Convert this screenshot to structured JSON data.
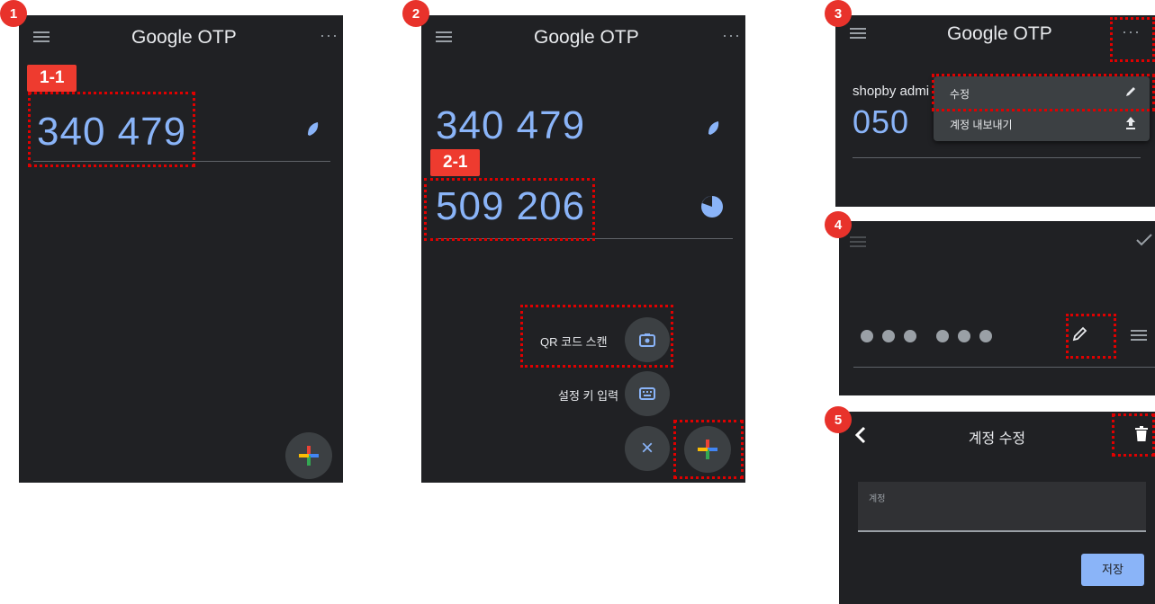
{
  "app_title": "Google OTP",
  "more_glyph": "···",
  "badges": [
    "1",
    "2",
    "3",
    "4",
    "5"
  ],
  "tags": {
    "t1": "1-1",
    "t2": "2-1"
  },
  "codes": {
    "code1": "340 479",
    "code2": "509 206",
    "code3_partial": "050"
  },
  "fab_menu": {
    "qr_label": "QR 코드 스캔",
    "key_label": "설정 키 입력",
    "close_glyph": "×"
  },
  "overflow_menu": {
    "account_partial": "shopby admi",
    "edit_label": "수정",
    "export_label": "계정 내보내기"
  },
  "edit_screen": {
    "title": "계정 수정",
    "field_label": "계정",
    "save_label": "저장"
  },
  "colors": {
    "dark_bg": "#202124",
    "code_blue": "#8ab4f8",
    "highlight_red": "#e00000",
    "badge_red": "#e8322b"
  },
  "icons": [
    "menu-icon",
    "more-icon",
    "timer-pie-icon",
    "plus-icon",
    "camera-icon",
    "keyboard-icon",
    "close-icon",
    "pencil-icon",
    "upload-icon",
    "check-icon",
    "reorder-icon",
    "back-icon",
    "trash-icon"
  ]
}
